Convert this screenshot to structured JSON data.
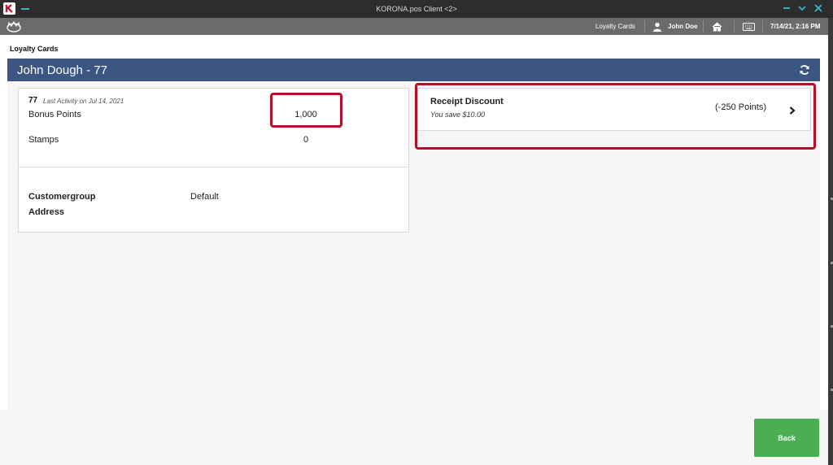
{
  "window": {
    "title": "KORONA.pos Client <2>"
  },
  "toolbar": {
    "loyalty_cards_label": "Loyalty Cards",
    "user_name": "John Doe",
    "datetime": "7/14/21, 2:16 PM"
  },
  "page": {
    "heading": "Loyalty Cards",
    "customer_title": "John Dough - 77"
  },
  "card": {
    "number": "77",
    "last_activity": "Last Activity on Jul 14, 2021",
    "bonus_points_label": "Bonus Points",
    "bonus_points_value": "1,000",
    "stamps_label": "Stamps",
    "stamps_value": "0",
    "customergroup_label": "Customergroup",
    "customergroup_value": "Default",
    "address_label": "Address"
  },
  "discount": {
    "title": "Receipt Discount",
    "subtitle": "You save $10.00",
    "points": "(-250 Points)"
  },
  "footer": {
    "back_label": "Back"
  },
  "colors": {
    "accent": "#3fb6c8",
    "header_bar": "#3c5683",
    "highlight": "#b0102a",
    "back_button": "#4cae52"
  }
}
